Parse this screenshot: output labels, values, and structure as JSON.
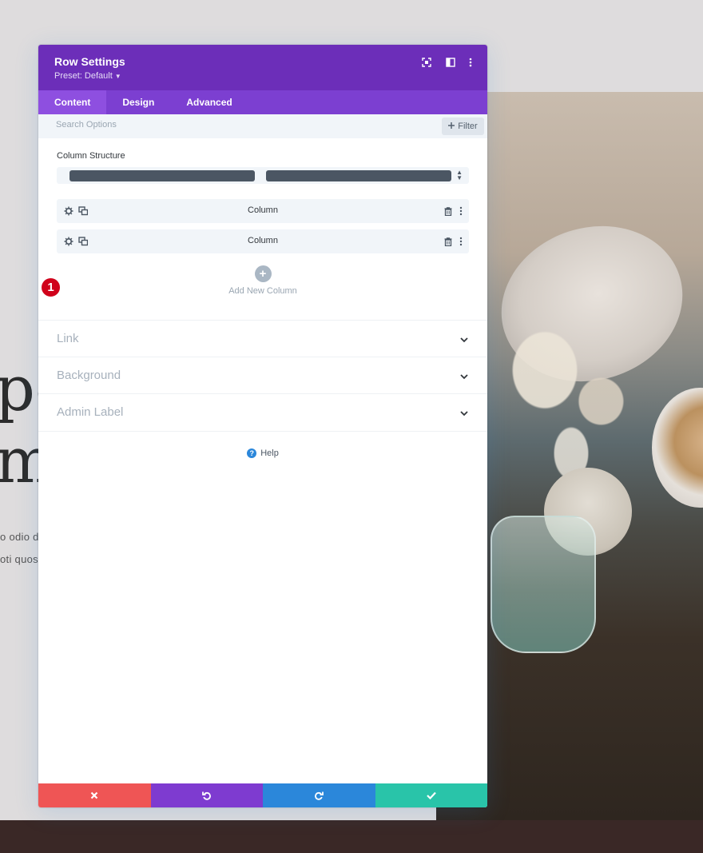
{
  "background_page": {
    "heading_line1": "pe",
    "heading_line2": "m",
    "text_line1": "o odio d",
    "text_line2": "oti quos"
  },
  "modal": {
    "title": "Row Settings",
    "preset": "Preset: Default",
    "header_icons": [
      "expand-icon",
      "sidebar-layout-icon",
      "more-vertical-icon"
    ],
    "tabs": [
      {
        "label": "Content",
        "active": true
      },
      {
        "label": "Design",
        "active": false
      },
      {
        "label": "Advanced",
        "active": false
      }
    ],
    "search": {
      "placeholder": "Search Options"
    },
    "filter_label": "Filter",
    "column_structure_label": "Column Structure",
    "columns": [
      {
        "label": "Column"
      },
      {
        "label": "Column"
      }
    ],
    "step_badge": "1",
    "add_column_label": "Add New Column",
    "toggles": [
      {
        "label": "Link"
      },
      {
        "label": "Background"
      },
      {
        "label": "Admin Label"
      }
    ],
    "help_label": "Help",
    "footer_buttons": [
      {
        "name": "discard",
        "icon": "close-icon",
        "color": "#ef5555"
      },
      {
        "name": "undo",
        "icon": "undo-icon",
        "color": "#7e3bd0"
      },
      {
        "name": "redo",
        "icon": "redo-icon",
        "color": "#2b87da"
      },
      {
        "name": "save",
        "icon": "check-icon",
        "color": "#29c4a9"
      }
    ]
  },
  "colors": {
    "header": "#6c2eb9",
    "tabs": "#7c3fd1",
    "active_tab": "#8e4fe0",
    "badge": "#d0021b"
  }
}
